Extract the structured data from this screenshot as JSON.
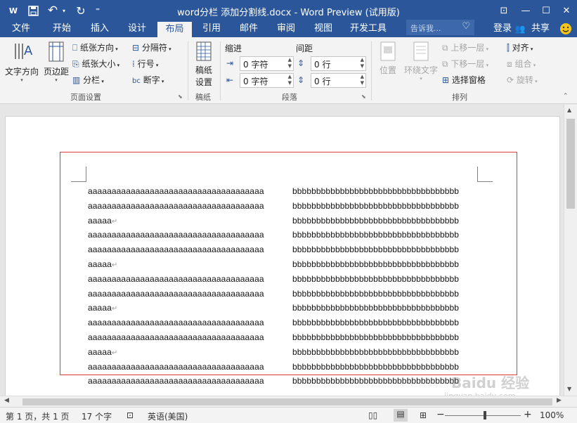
{
  "titlebar": {
    "title": "word分栏 添加分割线.docx - Word Preview (试用版)",
    "app_icon": "W",
    "save_icon": "save-icon",
    "undo_glyph": "↶",
    "redo_glyph": "↻",
    "customize_glyph": "⁼",
    "window_buttons": [
      "⊡",
      "—",
      "☐",
      "✕"
    ]
  },
  "tabs": [
    "文件",
    "开始",
    "插入",
    "设计",
    "布局",
    "引用",
    "邮件",
    "审阅",
    "视图",
    "开发工具"
  ],
  "active_tab": "布局",
  "tellme_placeholder": "告诉我...",
  "account": {
    "login": "登录",
    "share": "共享"
  },
  "ribbon": {
    "page_setup": {
      "text_direction": "文字方向",
      "margins": "页边距",
      "orientation": "纸张方向",
      "size": "纸张大小",
      "columns": "分栏",
      "breaks": "分隔符",
      "line_numbers": "行号",
      "hyphenation": "断字",
      "group": "页面设置"
    },
    "draft": {
      "setup": "稿纸设置",
      "setup_line2": "设置",
      "setup_line1": "稿纸",
      "group": "稿纸"
    },
    "paragraph": {
      "indent_label": "缩进",
      "spacing_label": "间距",
      "indent_left": "0 字符",
      "indent_right": "0 字符",
      "space_before": "0 行",
      "space_after": "0 行",
      "group": "段落"
    },
    "arrange": {
      "position": "位置",
      "wrap_text": "环绕文字",
      "bring_forward": "上移一层",
      "send_backward": "下移一层",
      "selection_pane": "选择窗格",
      "align": "对齐",
      "group_btn": "组合",
      "rotate": "旋转",
      "group": "排列"
    }
  },
  "document": {
    "left_column": [
      "aaaaaaaaaaaaaaaaaaaaaaaaaaaaaaaaaaaaa",
      "aaaaaaaaaaaaaaaaaaaaaaaaaaaaaaaaaaaaa",
      "aaaaa",
      "aaaaaaaaaaaaaaaaaaaaaaaaaaaaaaaaaaaaa",
      "aaaaaaaaaaaaaaaaaaaaaaaaaaaaaaaaaaaaa",
      "aaaaa",
      "aaaaaaaaaaaaaaaaaaaaaaaaaaaaaaaaaaaaa",
      "aaaaaaaaaaaaaaaaaaaaaaaaaaaaaaaaaaaaa",
      "aaaaa",
      "aaaaaaaaaaaaaaaaaaaaaaaaaaaaaaaaaaaaa",
      "aaaaaaaaaaaaaaaaaaaaaaaaaaaaaaaaaaaaa",
      "aaaaa",
      "aaaaaaaaaaaaaaaaaaaaaaaaaaaaaaaaaaaaa",
      "aaaaaaaaaaaaaaaaaaaaaaaaaaaaaaaaaaaaa"
    ],
    "left_para_marks": [
      false,
      false,
      true,
      false,
      false,
      true,
      false,
      false,
      true,
      false,
      false,
      true,
      false,
      false
    ],
    "right_column": [
      "bbbbbbbbbbbbbbbbbbbbbbbbbbbbbbbbbbb",
      "bbbbbbbbbbbbbbbbbbbbbbbbbbbbbbbbbbb",
      "bbbbbbbbbbbbbbbbbbbbbbbbbbbbbbbbbbb",
      "bbbbbbbbbbbbbbbbbbbbbbbbbbbbbbbbbbb",
      "bbbbbbbbbbbbbbbbbbbbbbbbbbbbbbbbbbb",
      "bbbbbbbbbbbbbbbbbbbbbbbbbbbbbbbbbbb",
      "bbbbbbbbbbbbbbbbbbbbbbbbbbbbbbbbbbb",
      "bbbbbbbbbbbbbbbbbbbbbbbbbbbbbbbbbbb",
      "bbbbbbbbbbbbbbbbbbbbbbbbbbbbbbbbbbb",
      "bbbbbbbbbbbbbbbbbbbbbbbbbbbbbbbbbbb",
      "bbbbbbbbbbbbbbbbbbbbbbbbbbbbbbbbbbb",
      "bbbbbbbbbbbbbbbbbbbbbbbbbbbbbbbbbbb",
      "bbbbbbbbbbbbbbbbbbbbbbbbbbbbbbbbbbb",
      "bbbbbbbbbbbbbbbbbbbbbbbbbbbbbbbbbbb"
    ],
    "para_mark": "↵"
  },
  "statusbar": {
    "page": "第 1 页，共 1 页",
    "words": "17 个字",
    "language": "英语(美国)",
    "zoom": "100%",
    "zoom_minus": "−",
    "zoom_plus": "+"
  },
  "colors": {
    "accent": "#2b579a",
    "separator_box": "#d83b3b"
  },
  "watermark": "Baidu 经验 jingyan.baidu.com"
}
